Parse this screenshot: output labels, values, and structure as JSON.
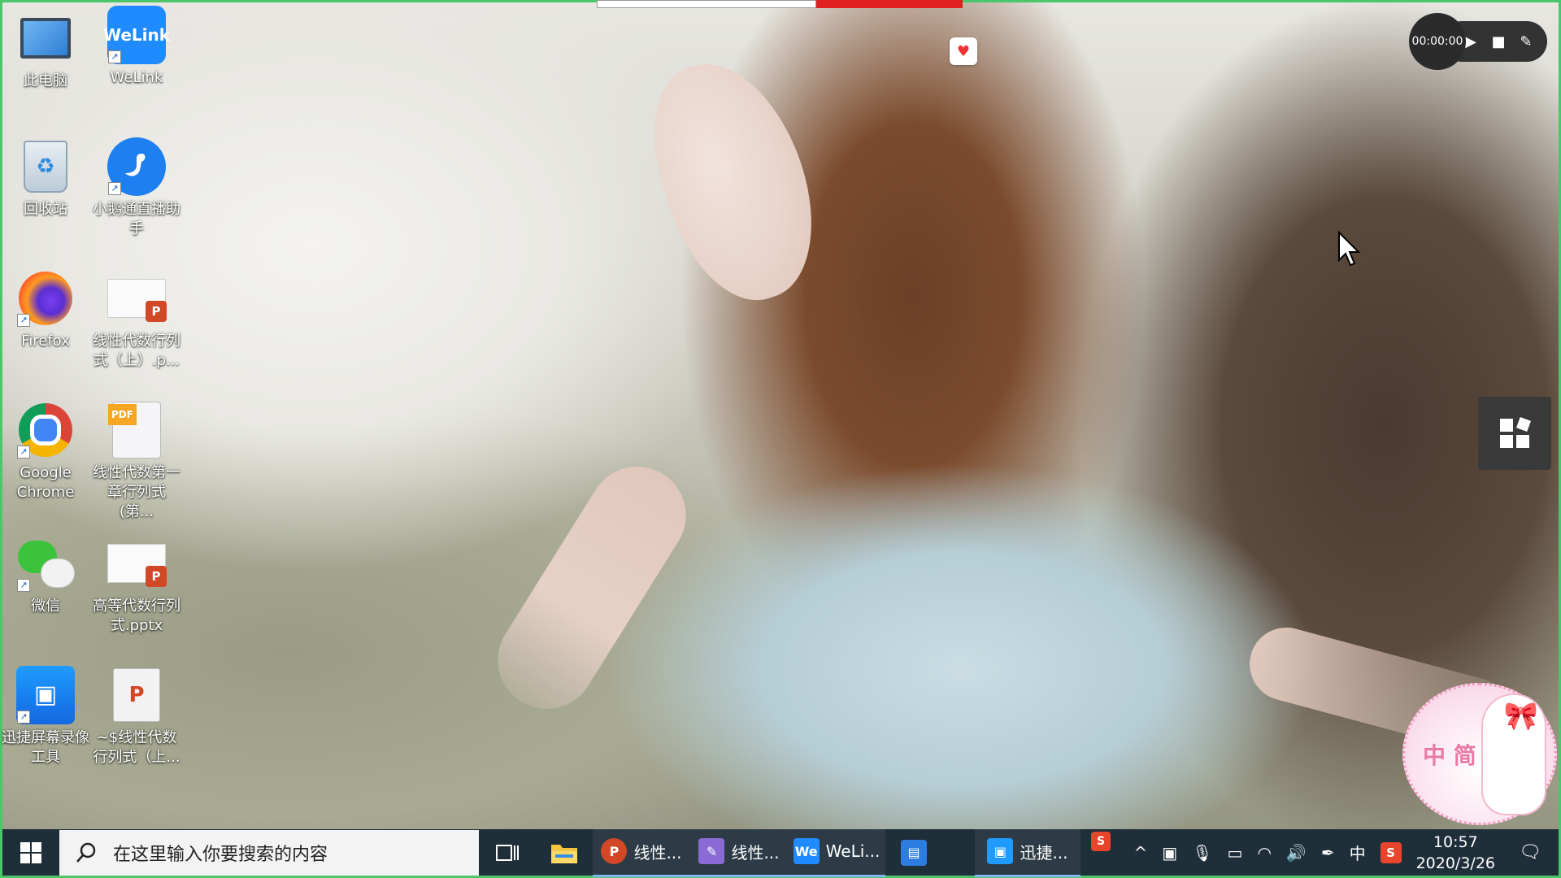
{
  "desktop": {
    "icons": [
      {
        "label": "此电脑",
        "icon": "computer-icon"
      },
      {
        "label": "WeLink",
        "icon": "welink-icon",
        "icon_text": "WeLink"
      },
      {
        "label": "回收站",
        "icon": "recycle-bin-icon"
      },
      {
        "label": "小鹅通直播助手",
        "icon": "goose-live-icon"
      },
      {
        "label": "Firefox",
        "icon": "firefox-icon"
      },
      {
        "label": "线性代数行列式（上）.p...",
        "icon": "pptx-file-icon"
      },
      {
        "label": "Google Chrome",
        "icon": "chrome-icon"
      },
      {
        "label": "线性代数第一章行列式(第...",
        "icon": "pdf-file-icon",
        "icon_text": "PDF"
      },
      {
        "label": "微信",
        "icon": "wechat-icon"
      },
      {
        "label": "高等代数行列式.pptx",
        "icon": "pptx-file-icon"
      },
      {
        "label": "迅捷屏幕录像工具",
        "icon": "screen-recorder-icon"
      },
      {
        "label": "~$线性代数行列式（上...",
        "icon": "ppt-temp-file-icon"
      }
    ]
  },
  "recorder": {
    "timer": "00:00:00",
    "play_icon": "play-icon",
    "stop_icon": "stop-icon",
    "pen_icon": "pen-icon"
  },
  "sticker": {
    "text": "中 简"
  },
  "taskbar": {
    "search_placeholder": "在这里输入你要搜索的内容",
    "apps": [
      {
        "label": "线性...",
        "icon": "powerpoint-icon",
        "icon_text": "P",
        "color": "#d24726"
      },
      {
        "label": "线性...",
        "icon": "pdf-reader-icon",
        "icon_text": "",
        "color": "#8a6bd6"
      },
      {
        "label": "WeLi...",
        "icon": "welink-icon",
        "icon_text": "We",
        "color": "#1f8bff"
      },
      {
        "label": "迅捷...",
        "icon": "screen-recorder-icon",
        "icon_text": "",
        "color": "#1f9bff"
      }
    ],
    "tray": {
      "ime": "中",
      "time": "10:57",
      "date": "2020/3/26"
    }
  },
  "colors": {
    "frame_border": "#4cc66a",
    "taskbar_bg": "#1f2f3a",
    "recording_red": "#e02020"
  }
}
